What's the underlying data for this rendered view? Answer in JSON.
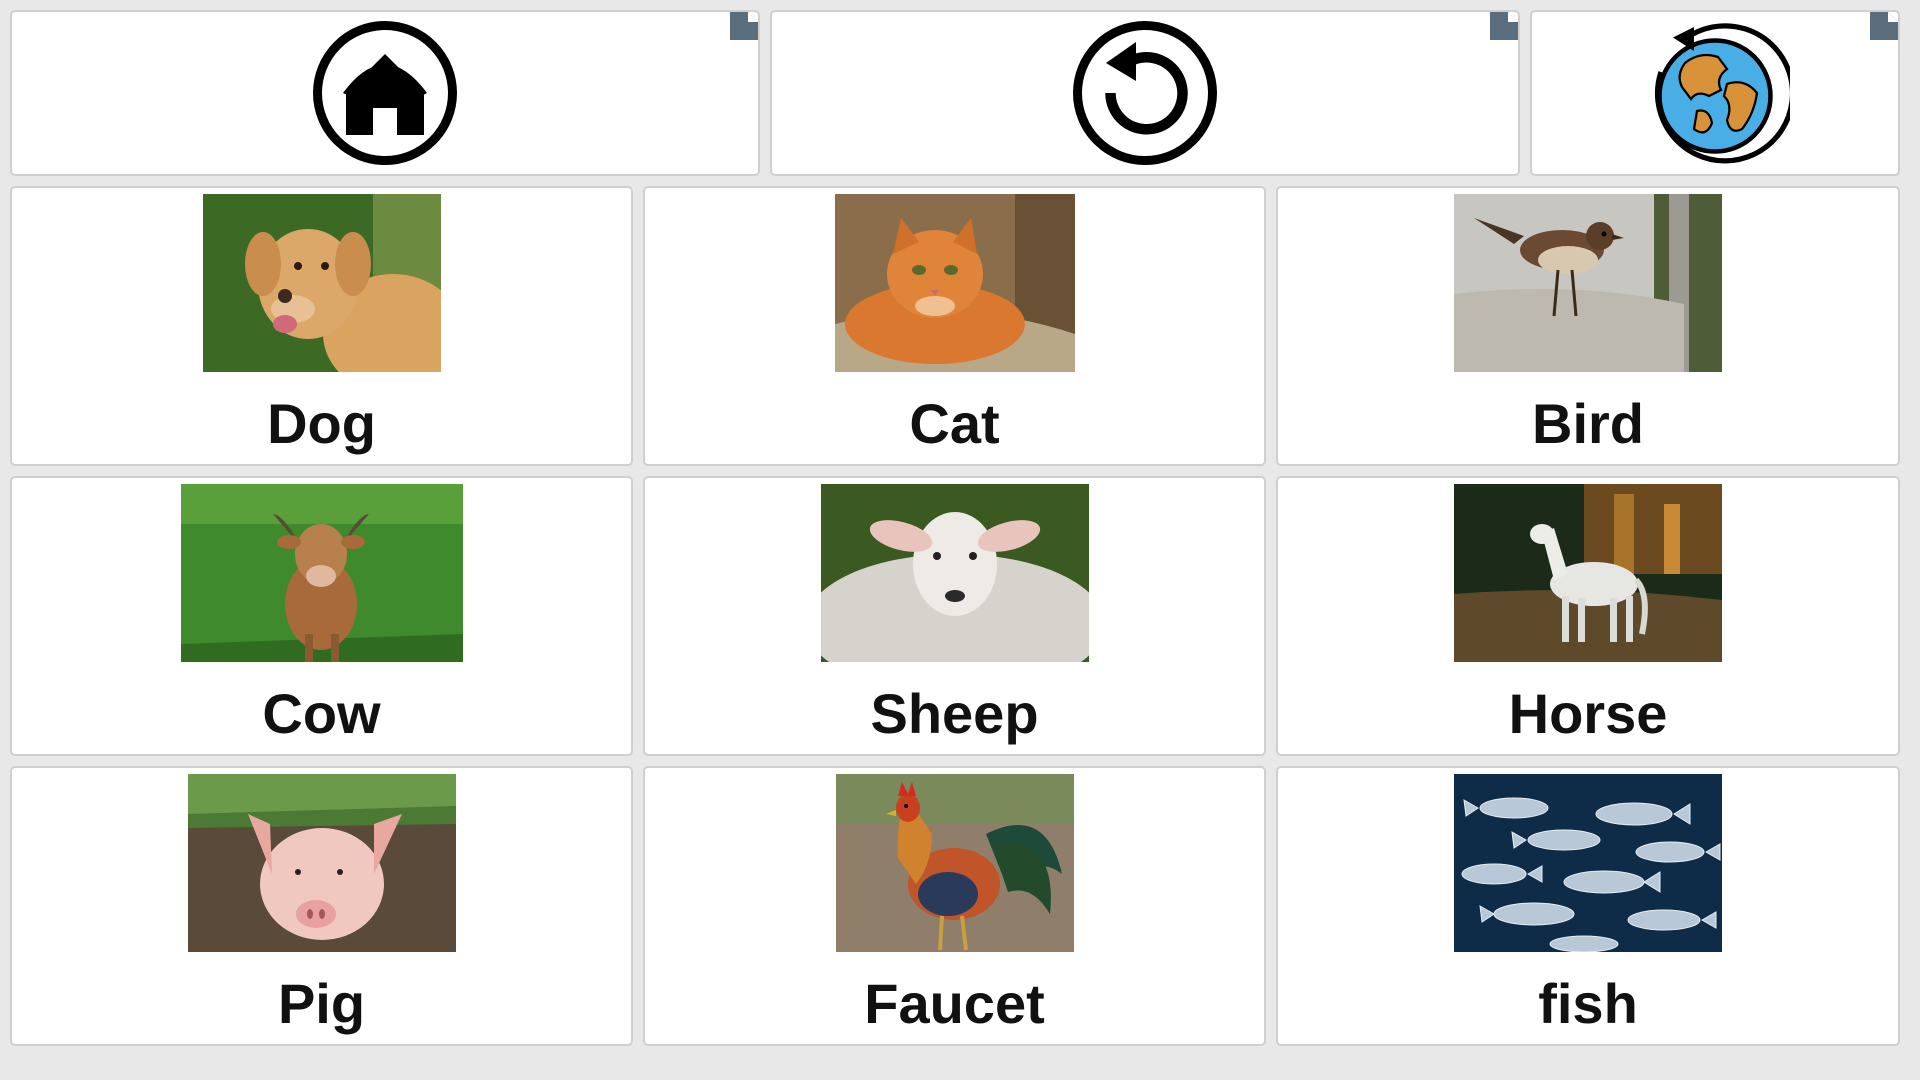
{
  "toolbar": {
    "home": {
      "icon": "home-icon"
    },
    "back": {
      "icon": "undo-arrow-icon"
    },
    "language": {
      "icon": "globe-refresh-icon"
    }
  },
  "grid": {
    "cells": [
      {
        "label": "Dog",
        "image": "dog-photo"
      },
      {
        "label": "Cat",
        "image": "cat-photo"
      },
      {
        "label": "Bird",
        "image": "bird-photo"
      },
      {
        "label": "Cow",
        "image": "cow-photo"
      },
      {
        "label": "Sheep",
        "image": "sheep-photo"
      },
      {
        "label": "Horse",
        "image": "horse-photo"
      },
      {
        "label": "Pig",
        "image": "pig-photo"
      },
      {
        "label": "Faucet",
        "image": "rooster-photo"
      },
      {
        "label": "fish",
        "image": "fish-photo"
      }
    ]
  },
  "colors": {
    "background": "#e8e8e8",
    "tile": "#ffffff",
    "tile_border": "#cfcfcf",
    "fold_marker": "#5a6d7c",
    "globe_ocean": "#4aaee6",
    "globe_land": "#d8923a"
  }
}
